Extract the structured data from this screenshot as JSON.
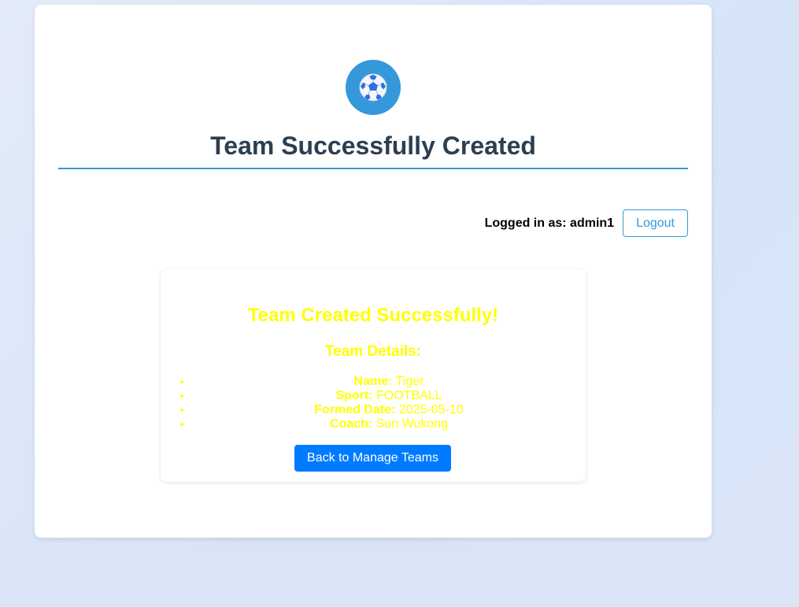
{
  "header": {
    "logo_icon": "soccer-ball-icon",
    "title": "Team Successfully Created",
    "accent_color": "#3498db"
  },
  "user": {
    "logged_in_text": "Logged in as: admin1",
    "logout_label": "Logout"
  },
  "result": {
    "heading": "Team Created Successfully!",
    "details_heading": "Team Details:",
    "text_color": "#ffff00",
    "details": [
      {
        "label": "Name:",
        "value": "Tiger"
      },
      {
        "label": "Sport:",
        "value": "FOOTBALL"
      },
      {
        "label": "Formed Date:",
        "value": "2025-05-10"
      },
      {
        "label": "Coach:",
        "value": "Sun Wukong"
      }
    ],
    "back_label": "Back to Manage Teams",
    "button_color": "#007bff"
  }
}
